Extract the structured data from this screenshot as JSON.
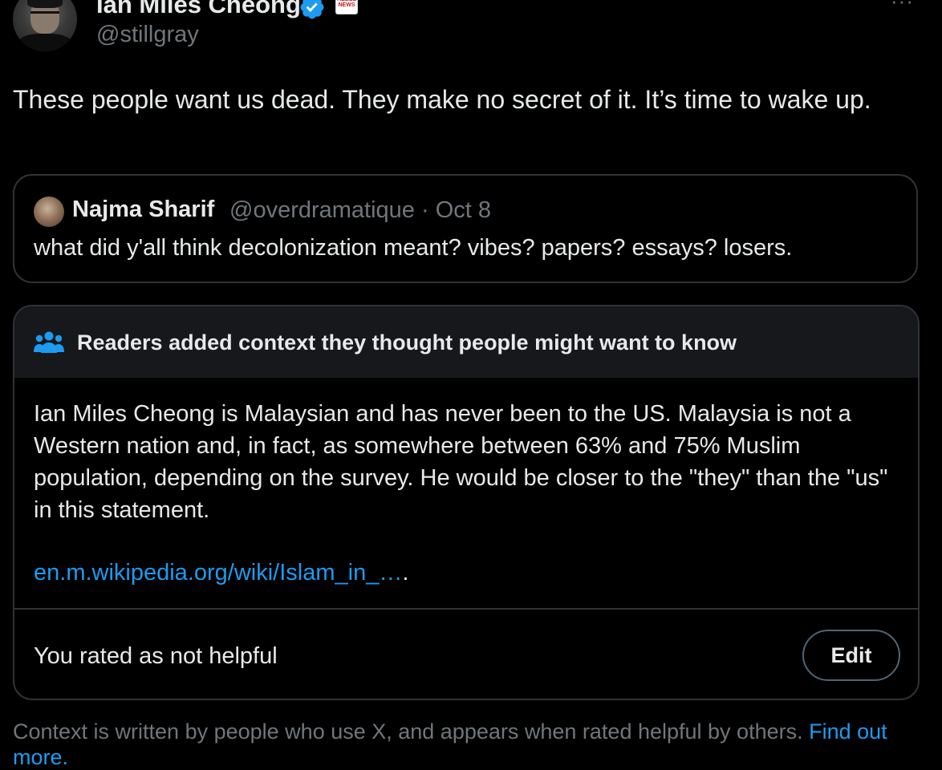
{
  "author": {
    "name": "Ian Miles Cheong",
    "handle": "@stillgray",
    "affiliate_badge_text": "REBEL NEWS"
  },
  "tweet": {
    "text": "These people want us dead. They make no secret of it. It’s time to wake up."
  },
  "quote": {
    "name": "Najma Sharif",
    "meta": "@overdramatique · Oct 8",
    "text": "what did y'all think decolonization meant? vibes? papers? essays? losers."
  },
  "community_note": {
    "header": "Readers added context they thought people might want to know",
    "body": "Ian Miles Cheong is Malaysian and has never been to the US. Malaysia is not a Western nation and, in fact, as somewhere between 63% and 75% Muslim population, depending on the survey. He would be closer to the \"they\" than the \"us\" in this statement.",
    "link_text": "en.m.wikipedia.org/wiki/Islam_in_…",
    "link_trailing": ".",
    "rating_status": "You rated as not helpful",
    "edit_label": "Edit"
  },
  "footer": {
    "text": "Context is written by people who use X, and appears when rated helpful by others.",
    "link_text": "Find out more."
  },
  "colors": {
    "background": "#000000",
    "text_primary": "#e7e9ea",
    "text_secondary": "#71767b",
    "accent_blue": "#1d9bf0",
    "border": "#2f3336",
    "note_header_bg": "#16181c"
  },
  "icons": {
    "verified": "verified-badge-icon",
    "people": "people-icon",
    "more": "more-icon"
  }
}
